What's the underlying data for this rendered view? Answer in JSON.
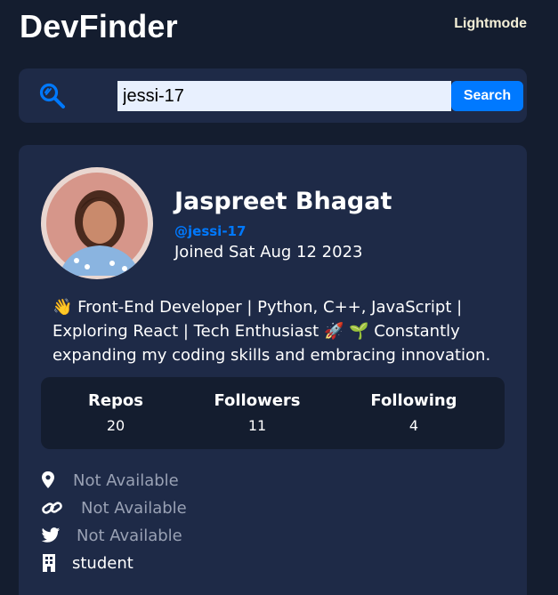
{
  "header": {
    "app_title": "DevFinder",
    "theme_toggle_label": "Lightmode"
  },
  "search": {
    "value": "jessi-17",
    "button_label": "Search"
  },
  "profile": {
    "name": "Jaspreet Bhagat",
    "login": "@jessi-17",
    "joined": "Joined Sat Aug 12 2023",
    "bio": "👋 Front-End Developer | Python, C++, JavaScript | Exploring React | Tech Enthusiast 🚀 🌱 Constantly expanding my coding skills and embracing innovation.",
    "stats": {
      "repos_label": "Repos",
      "repos_value": "20",
      "followers_label": "Followers",
      "followers_value": "11",
      "following_label": "Following",
      "following_value": "4"
    },
    "links": {
      "location": "Not Available",
      "blog": "Not Available",
      "twitter": "Not Available",
      "company": "student"
    }
  },
  "colors": {
    "background": "#141d2f",
    "card": "#1e2a47",
    "accent": "#0079ff",
    "muted_text": "#99a1b4"
  },
  "icons": [
    "search-icon",
    "location-pin-icon",
    "link-icon",
    "twitter-icon",
    "building-icon"
  ]
}
